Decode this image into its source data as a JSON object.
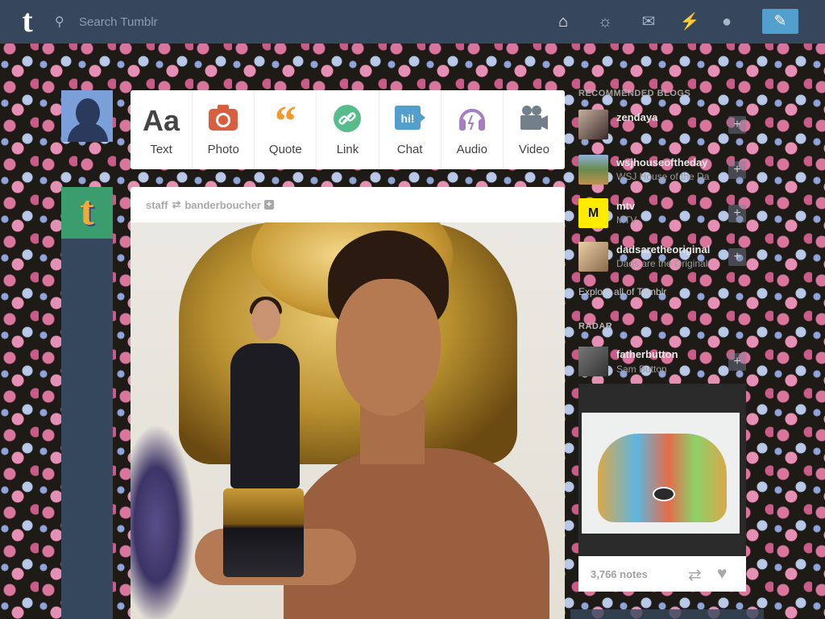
{
  "header": {
    "logo": "t",
    "search_placeholder": "Search Tumblr",
    "nav_icons": [
      "home-icon",
      "explore-icon",
      "inbox-icon",
      "activity-icon",
      "account-icon"
    ],
    "compose_icon": "pencil-icon"
  },
  "post_types": [
    {
      "label": "Text",
      "glyph": "Aa",
      "color": "#444444"
    },
    {
      "label": "Photo",
      "glyph": "📷",
      "color": "#d95e40"
    },
    {
      "label": "Quote",
      "glyph": "❝",
      "color": "#f2992e"
    },
    {
      "label": "Link",
      "glyph": "🔗",
      "color": "#56bc8a"
    },
    {
      "label": "Chat",
      "glyph": "hi!",
      "color": "#529ecc"
    },
    {
      "label": "Audio",
      "glyph": "🎧",
      "color": "#a77dc2"
    },
    {
      "label": "Video",
      "glyph": "🎥",
      "color": "#748089"
    }
  ],
  "post": {
    "author": "staff",
    "reblogged_from": "banderboucher",
    "follow_symbol": "+"
  },
  "recommended": {
    "title": "RECOMMENDED BLOGS",
    "items": [
      {
        "name": "zendaya",
        "subtitle": "",
        "avatar_color": "#3a2a2a"
      },
      {
        "name": "wsjhouseoftheday",
        "subtitle": "WSJ House of the Da",
        "avatar_color": "#6b8a4a"
      },
      {
        "name": "mtv",
        "subtitle": "MTV",
        "avatar_color": "#ffec00"
      },
      {
        "name": "dadsaretheoriginal",
        "subtitle": "Dads are the Original",
        "avatar_color": "#c8a880"
      }
    ],
    "follow_symbol": "+",
    "explore_link": "Explore all of Tumblr"
  },
  "radar": {
    "title": "RADAR",
    "user": "fatherbutton",
    "user_subtitle": "Sam Button",
    "follow_symbol": "+",
    "notes": "3,766 notes"
  }
}
